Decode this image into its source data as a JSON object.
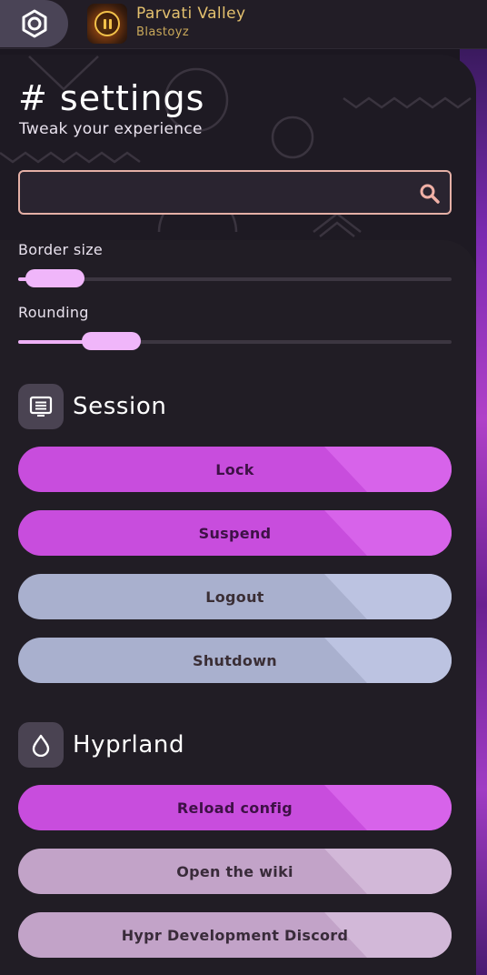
{
  "topbar": {
    "settings_icon": "gear-icon",
    "media": {
      "title": "Parvati Valley",
      "artist": "Blastoyz",
      "state_icon": "pause-icon"
    }
  },
  "page": {
    "title": "# settings",
    "subtitle": "Tweak your experience"
  },
  "search": {
    "value": "",
    "placeholder": "",
    "icon": "search-icon"
  },
  "sliders": [
    {
      "label": "Border size",
      "value_fraction": 0.04
    },
    {
      "label": "Rounding",
      "value_fraction": 0.22
    }
  ],
  "sections": [
    {
      "title": "Session",
      "icon": "list-icon",
      "buttons": [
        "Lock",
        "Suspend",
        "Logout",
        "Shutdown"
      ]
    },
    {
      "title": "Hyprland",
      "icon": "drop-icon",
      "buttons": [
        "Reload config",
        "Open the wiki",
        "Hypr Development Discord"
      ]
    }
  ],
  "colors": {
    "accent": "#c84ddd",
    "accent_light": "#eeb1f7",
    "secondary": "#a9b0ce",
    "tertiary": "#c2a3c8",
    "search_border": "#e5b0a6",
    "panel_bg": "#1e1a23"
  }
}
